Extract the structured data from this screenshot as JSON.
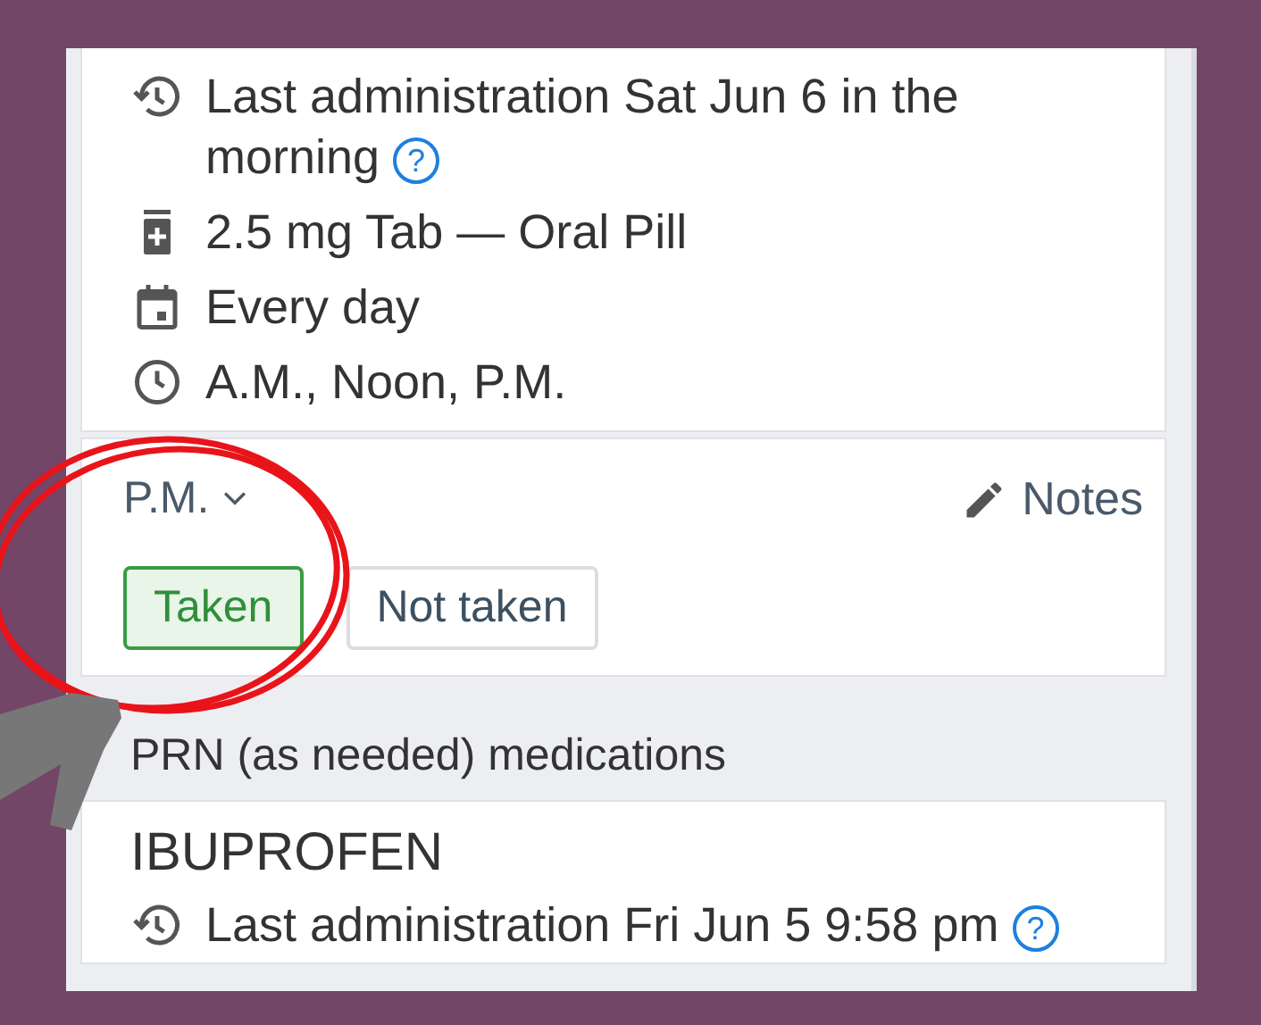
{
  "medication": {
    "details": [
      {
        "kind": "history",
        "text": "Last administration Sat Jun 6 in the morning",
        "help": "?"
      },
      {
        "kind": "pill",
        "text": "2.5 mg Tab — Oral Pill"
      },
      {
        "kind": "calendar",
        "text": "Every day"
      },
      {
        "kind": "clock",
        "text": "A.M., Noon, P.M."
      }
    ],
    "dose": {
      "time": "P.M.",
      "notes": "Notes",
      "buttons": [
        {
          "label": "Taken",
          "selected": true
        },
        {
          "label": "Not taken",
          "selected": false
        }
      ]
    }
  },
  "prn": {
    "heading": "PRN (as needed) medications",
    "name": "IBUPROFEN",
    "details": [
      {
        "kind": "history",
        "text": "Last administration Fri Jun 5 9:58 pm",
        "help": "?"
      }
    ]
  }
}
